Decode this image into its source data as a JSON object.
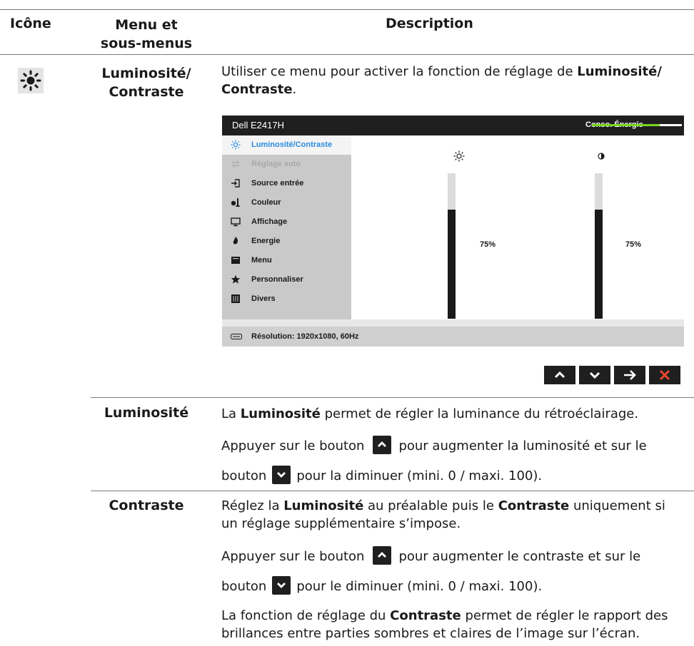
{
  "header": {
    "col1": "Icône",
    "col2_line1": "Menu et",
    "col2_line2": "sous-menus",
    "col3": "Description"
  },
  "row_main": {
    "name_line1": "Luminosité/",
    "name_line2": "Contraste",
    "desc_prefix": "Utiliser ce menu pour activer la fonction de réglage de ",
    "desc_bold1": "Luminosité/",
    "desc_bold2": "Contraste",
    "desc_suffix": "."
  },
  "osd": {
    "title": "Dell E2417H",
    "energy_label": "Conso. Énergie",
    "energy_level": 0.75,
    "menu": [
      {
        "label": "Luminosité/Contraste",
        "icon": "sun-icon",
        "state": "active"
      },
      {
        "label": "Réglage auto",
        "icon": "auto-adjust-icon",
        "state": "disabled"
      },
      {
        "label": "Source entrée",
        "icon": "input-source-icon",
        "state": "normal"
      },
      {
        "label": "Couleur",
        "icon": "color-icon",
        "state": "normal"
      },
      {
        "label": "Affichage",
        "icon": "display-icon",
        "state": "normal"
      },
      {
        "label": "Energie",
        "icon": "power-icon",
        "state": "normal"
      },
      {
        "label": "Menu",
        "icon": "menu-icon",
        "state": "normal"
      },
      {
        "label": "Personnaliser",
        "icon": "star-icon",
        "state": "normal"
      },
      {
        "label": "Divers",
        "icon": "others-icon",
        "state": "normal"
      }
    ],
    "brightness_value": "75%",
    "brightness_level": 0.75,
    "contrast_value": "75%",
    "contrast_level": 0.75,
    "resolution": "Résolution: 1920x1080, 60Hz"
  },
  "nav_buttons": [
    "up",
    "down",
    "right",
    "close"
  ],
  "row_luminosite": {
    "name": "Luminosité",
    "p1_prefix": "La ",
    "p1_bold": "Luminosité",
    "p1_suffix": " permet de régler la luminance du rétroéclairage.",
    "p2_before": "Appuyer sur le bouton",
    "p2_after": "pour augmenter la luminosité et sur le",
    "p3_before": "bouton",
    "p3_after": "pour la diminuer (mini. 0 / maxi. 100)."
  },
  "row_contraste": {
    "name": "Contraste",
    "p1_a": "Réglez la ",
    "p1_b": "Luminosité",
    "p1_c": " au préalable puis le ",
    "p1_d": "Contraste",
    "p1_e": " uniquement si",
    "p1_line2": "un réglage supplémentaire s’impose.",
    "p2_before": "Appuyer sur le bouton",
    "p2_after": "pour augmenter le contraste et sur le",
    "p3_before": "bouton",
    "p3_after": "pour le diminuer (mini. 0 / maxi. 100).",
    "p4_a": "La fonction de réglage du ",
    "p4_b": "Contraste",
    "p4_c": " permet de régler le rapport des",
    "p4_line2": "brillances entre parties sombres et claires de l’image sur l’écran."
  }
}
